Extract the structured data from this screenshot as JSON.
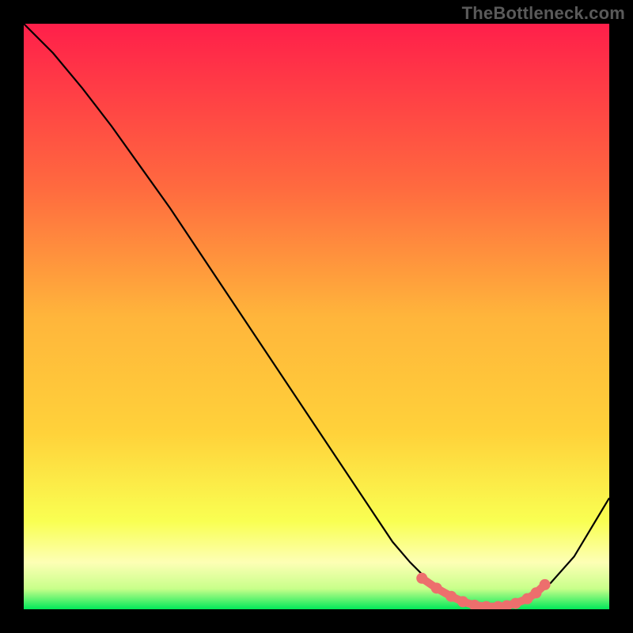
{
  "watermark": "TheBottleneck.com",
  "colors": {
    "background": "#000000",
    "gradient_top": "#ff1f4a",
    "gradient_upper_mid": "#ff8a3d",
    "gradient_mid": "#ffd23a",
    "gradient_lower_mid": "#f9ff52",
    "gradient_pale_band": "#fdffb5",
    "gradient_bottom": "#00e859",
    "curve": "#000000",
    "marker": "#ed6f6d"
  },
  "chart_data": {
    "type": "line",
    "title": "",
    "xlabel": "",
    "ylabel": "",
    "xlim": [
      0,
      100
    ],
    "ylim": [
      0,
      100
    ],
    "grid": false,
    "legend": false,
    "series": [
      {
        "name": "bottleneck-curve",
        "x": [
          0,
          5,
          10,
          15,
          20,
          25,
          30,
          35,
          40,
          45,
          50,
          55,
          60,
          63,
          66,
          70,
          74,
          78,
          82,
          86,
          90,
          94,
          100
        ],
        "y": [
          100,
          95,
          89,
          82.5,
          75.5,
          68.5,
          61,
          53.5,
          46,
          38.5,
          31,
          23.5,
          16,
          11.5,
          8,
          4,
          1.5,
          0.5,
          0.5,
          1.5,
          4.5,
          9,
          19
        ]
      }
    ],
    "markers": {
      "name": "highlighted-segment",
      "x": [
        68,
        70.5,
        73,
        75,
        77,
        79,
        81,
        82.5,
        84,
        86,
        87.5,
        89
      ],
      "y": [
        5.3,
        3.6,
        2.2,
        1.3,
        0.7,
        0.45,
        0.45,
        0.6,
        1.0,
        1.8,
        2.8,
        4.2
      ]
    }
  }
}
